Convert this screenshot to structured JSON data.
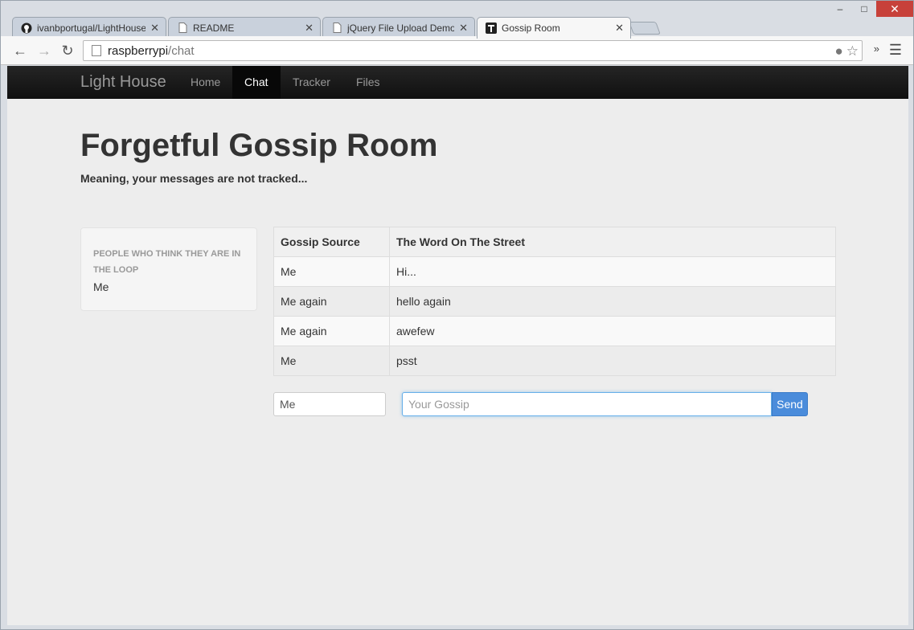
{
  "browser": {
    "tabs": [
      {
        "title": "ivanbportugal/LightHouse",
        "icon": "github-icon"
      },
      {
        "title": "README",
        "icon": "page-icon"
      },
      {
        "title": "jQuery File Upload Demo",
        "icon": "page-icon"
      },
      {
        "title": "Gossip Room",
        "icon": "lighthouse-icon",
        "active": true
      }
    ],
    "url": {
      "host": "raspberrypi",
      "path": "/chat"
    }
  },
  "navbar": {
    "brand": "Light House",
    "items": [
      {
        "label": "Home",
        "active": false
      },
      {
        "label": "Chat",
        "active": true
      },
      {
        "label": "Tracker",
        "active": false
      },
      {
        "label": "Files",
        "active": false
      }
    ]
  },
  "main": {
    "title": "Forgetful Gossip Room",
    "subtitle": "Meaning, your messages are not tracked..."
  },
  "sidebar": {
    "header": "PEOPLE WHO THINK THEY ARE IN THE LOOP",
    "users": [
      "Me"
    ]
  },
  "table": {
    "headers": [
      "Gossip Source",
      "The Word On The Street"
    ],
    "rows": [
      [
        "Me",
        "Hi..."
      ],
      [
        "Me again",
        "hello again"
      ],
      [
        "Me again",
        "awefew"
      ],
      [
        "Me",
        "psst"
      ]
    ]
  },
  "form": {
    "name_value": "Me",
    "gossip_placeholder": "Your Gossip",
    "send_label": "Send"
  },
  "colors": {
    "navbar_bg": "#1b1b1b",
    "send_button": "#4a8cdb",
    "page_bg": "#ededed"
  }
}
